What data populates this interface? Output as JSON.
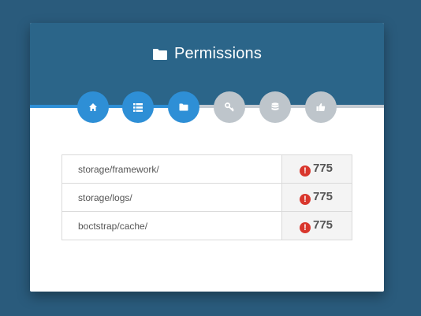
{
  "header": {
    "icon": "folder-icon",
    "title": "Permissions"
  },
  "steps": [
    {
      "name": "home",
      "icon": "home-icon",
      "state": "done"
    },
    {
      "name": "requirements",
      "icon": "list-icon",
      "state": "done"
    },
    {
      "name": "permissions",
      "icon": "folder-icon",
      "state": "done"
    },
    {
      "name": "environment",
      "icon": "key-icon",
      "state": "todo"
    },
    {
      "name": "database",
      "icon": "database-icon",
      "state": "todo"
    },
    {
      "name": "finish",
      "icon": "thumbs-up-icon",
      "state": "todo"
    }
  ],
  "colors": {
    "background": "#2a5b7c",
    "header": "#2b6589",
    "step_done": "#2e8fd6",
    "step_todo": "#bec5cb",
    "error": "#d9372d"
  },
  "permissions": {
    "rows": [
      {
        "path": "storage/framework/",
        "status_icon": "error-icon",
        "code": "775"
      },
      {
        "path": "storage/logs/",
        "status_icon": "error-icon",
        "code": "775"
      },
      {
        "path": "boctstrap/cache/",
        "status_icon": "error-icon",
        "code": "775"
      }
    ]
  }
}
